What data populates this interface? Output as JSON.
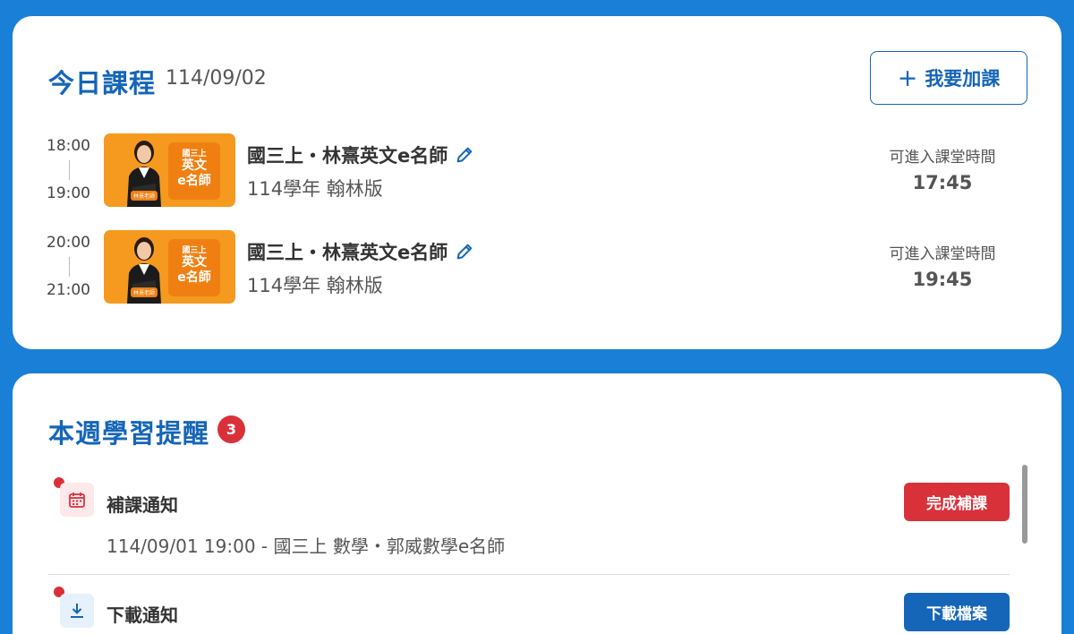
{
  "today": {
    "title": "今日課程",
    "date": "114/09/02",
    "add_button": "我要加課",
    "courses": [
      {
        "start": "18:00",
        "end": "19:00",
        "thumb_tag1": "國三上",
        "thumb_tag2": "英文",
        "thumb_tag3": "e名師",
        "thumb_name": "林熹老師",
        "name": "國三上・林熹英文e名師",
        "sub": "114學年 翰林版",
        "enter_label": "可進入課堂時間",
        "enter_time": "17:45"
      },
      {
        "start": "20:00",
        "end": "21:00",
        "thumb_tag1": "國三上",
        "thumb_tag2": "英文",
        "thumb_tag3": "e名師",
        "thumb_name": "林熹老師",
        "name": "國三上・林熹英文e名師",
        "sub": "114學年 翰林版",
        "enter_label": "可進入課堂時間",
        "enter_time": "19:45"
      }
    ]
  },
  "reminders": {
    "title": "本週學習提醒",
    "count": "3",
    "items": [
      {
        "icon": "calendar-icon",
        "title": "補課通知",
        "desc": "114/09/01 19:00 - 國三上 數學・郭威數學e名師",
        "button": "完成補課"
      },
      {
        "icon": "download-icon",
        "title": "下載通知",
        "button": "下載檔案"
      }
    ]
  },
  "colors": {
    "background": "#1a7fd6",
    "primary": "#1565b8",
    "alert": "#d9313a",
    "thumbnail": "#f59a1e"
  }
}
